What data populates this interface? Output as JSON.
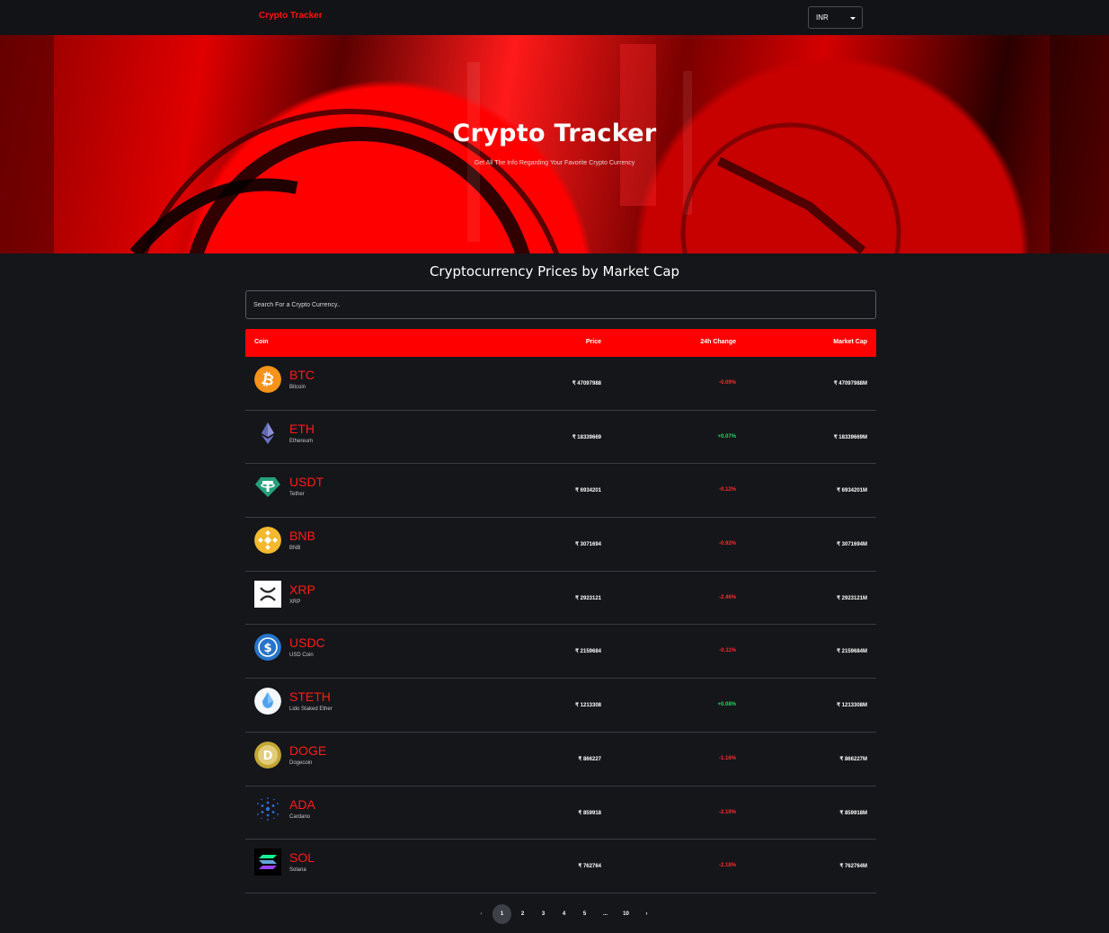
{
  "navbar": {
    "brand": "Crypto Tracker",
    "currency": "INR"
  },
  "hero": {
    "title": "Crypto Tracker",
    "subtitle": "Get All The Info Regarding Your Favorite Crypto Currency"
  },
  "main": {
    "title": "Cryptocurrency Prices by Market Cap",
    "search_placeholder": "Search For a Crypto Currency.."
  },
  "table": {
    "headers": {
      "coin": "Coin",
      "price": "Price",
      "change": "24h Change",
      "cap": "Market Cap"
    },
    "rows": [
      {
        "symbol": "BTC",
        "name": "Bitcoin",
        "price": "₹ 47097988",
        "change": "-0.09%",
        "positive": false,
        "cap": "₹ 47097988M",
        "icon": "bitcoin-icon"
      },
      {
        "symbol": "ETH",
        "name": "Ethereum",
        "price": "₹ 18339669",
        "change": "+0.07%",
        "positive": true,
        "cap": "₹ 18339669M",
        "icon": "ethereum-icon"
      },
      {
        "symbol": "USDT",
        "name": "Tether",
        "price": "₹ 6934201",
        "change": "-0.12%",
        "positive": false,
        "cap": "₹ 6934201M",
        "icon": "tether-icon"
      },
      {
        "symbol": "BNB",
        "name": "BNB",
        "price": "₹ 3071694",
        "change": "-0.92%",
        "positive": false,
        "cap": "₹ 3071694M",
        "icon": "bnb-icon"
      },
      {
        "symbol": "XRP",
        "name": "XRP",
        "price": "₹ 2923121",
        "change": "-2.46%",
        "positive": false,
        "cap": "₹ 2923121M",
        "icon": "xrp-icon"
      },
      {
        "symbol": "USDC",
        "name": "USD Coin",
        "price": "₹ 2159684",
        "change": "-0.11%",
        "positive": false,
        "cap": "₹ 2159684M",
        "icon": "usdc-icon"
      },
      {
        "symbol": "STETH",
        "name": "Lido Staked Ether",
        "price": "₹ 1213308",
        "change": "+0.08%",
        "positive": true,
        "cap": "₹ 1213308M",
        "icon": "steth-icon"
      },
      {
        "symbol": "DOGE",
        "name": "Dogecoin",
        "price": "₹ 866227",
        "change": "-1.16%",
        "positive": false,
        "cap": "₹ 866227M",
        "icon": "dogecoin-icon"
      },
      {
        "symbol": "ADA",
        "name": "Cardano",
        "price": "₹ 859918",
        "change": "-2.19%",
        "positive": false,
        "cap": "₹ 859918M",
        "icon": "cardano-icon"
      },
      {
        "symbol": "SOL",
        "name": "Solana",
        "price": "₹ 762764",
        "change": "-2.18%",
        "positive": false,
        "cap": "₹ 762764M",
        "icon": "solana-icon"
      }
    ]
  },
  "pagination": {
    "prev": "‹",
    "pages": [
      "1",
      "2",
      "3",
      "4",
      "5",
      "...",
      "10"
    ],
    "next": "›",
    "active": "1"
  },
  "colors": {
    "accent": "#ff0000",
    "negative": "#ff2a2a",
    "positive": "#1ed760",
    "background": "#15161a"
  }
}
